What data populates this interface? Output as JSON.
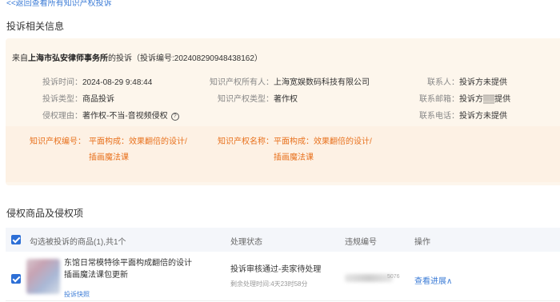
{
  "back_link": "<<返回查看所有知识产权投诉",
  "section1_title": "投诉相关信息",
  "complaint": {
    "from_prefix": "来自",
    "from_company": "上海市弘安律师事务所",
    "from_suffix": "的投诉（投诉编号:20240829094843816​2）",
    "fields": {
      "time_label": "投诉时间：",
      "time_value": "2024-08-29 9:48:44",
      "type_label": "投诉类型：",
      "type_value": "商品投诉",
      "reason_label": "侵权理由：",
      "reason_value": "著作权-不当-音视频侵权",
      "owner_label": "知识产权所有人：",
      "owner_value": "上海宽娱数码科技有限公司",
      "iptype_label": "知识产权类型：",
      "iptype_value": "著作权",
      "contact_label": "联系人：",
      "contact_value": "投诉方未提供",
      "email_label": "联系邮箱：",
      "email_value": "投诉方▒▒提供",
      "phone_label": "联系电话：",
      "phone_value": "投诉方未提供"
    },
    "ip": {
      "number_label": "知识产权编号：",
      "number_line1": "平面构成：效果翻倍的设计/",
      "number_line2": "插画魔法课",
      "name_label": "知识产权名称：",
      "name_line1": "平面构成：效果翻倍的设计/",
      "name_line2": "插画魔法课"
    }
  },
  "section2_title": "侵权商品及侵权项",
  "table": {
    "header_select": "勾选被投诉的商品(1),共1个",
    "header_status": "处理状态",
    "header_violation": "违规编号",
    "header_action": "操作"
  },
  "product": {
    "name": "东馆日常模特徐平面构成翻倍的设计插画魔法课包更新",
    "tag": "投诉快照",
    "status": "投诉审核通过-卖家待处理",
    "remaining": "剩余处理时间:4天23时58分",
    "violation_partial": "5076",
    "action": "查看进展∧"
  },
  "colors": {
    "accent_blue": "#3b7bd6",
    "orange": "#e8711d",
    "card_bg": "#fdf6ec"
  }
}
